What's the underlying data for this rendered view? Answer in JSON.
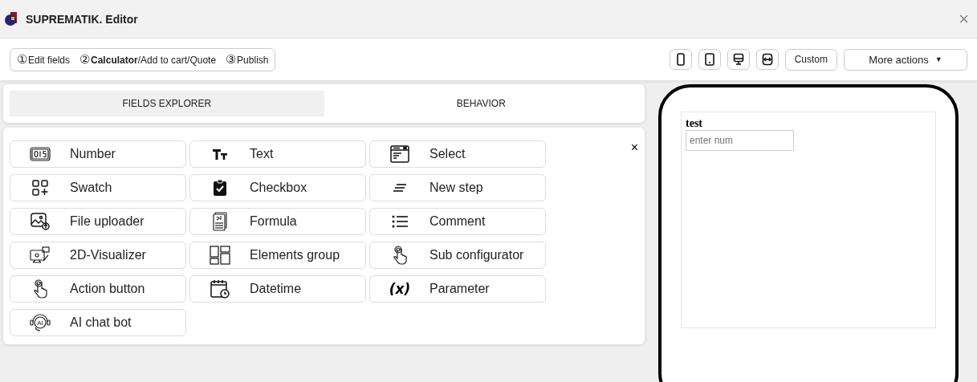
{
  "window": {
    "title": "SUPREMATIK. Editor",
    "close": "×"
  },
  "steps": [
    {
      "number": "①",
      "label": "Edit fields"
    },
    {
      "number": "②",
      "label": "**Calculator**/Add to cart/Quote"
    },
    {
      "number": "③",
      "label": "Publish"
    }
  ],
  "device_buttons": [
    {
      "kind": "phone"
    },
    {
      "kind": "tablet"
    },
    {
      "kind": "desktop"
    },
    {
      "kind": "fit"
    }
  ],
  "custom_button": "Custom",
  "more_actions": {
    "label": "More actions",
    "caret": "▼"
  },
  "tabs": [
    {
      "label": "FIELDS EXPLORER",
      "selected": true
    },
    {
      "label": "BEHAVIOR",
      "selected": false
    }
  ],
  "fields_close": "×",
  "fields": [
    {
      "kind": "number",
      "label": "Number"
    },
    {
      "kind": "text",
      "label": "Text"
    },
    {
      "kind": "select",
      "label": "Select"
    },
    {
      "kind": "swatch",
      "label": "Swatch"
    },
    {
      "kind": "checkbox",
      "label": "Checkbox"
    },
    {
      "kind": "step",
      "label": "New step"
    },
    {
      "kind": "upload",
      "label": "File uploader"
    },
    {
      "kind": "formula",
      "label": "Formula"
    },
    {
      "kind": "comment",
      "label": "Comment"
    },
    {
      "kind": "visualizer",
      "label": "2D-Visualizer"
    },
    {
      "kind": "group",
      "label": "Elements group"
    },
    {
      "kind": "tap",
      "label": "Sub configurator"
    },
    {
      "kind": "tap",
      "label": "Action button"
    },
    {
      "kind": "calendar",
      "label": "Datetime"
    },
    {
      "kind": "parameter",
      "label": "Parameter",
      "glyph": "(x)"
    },
    {
      "kind": "bot",
      "label": "AI chat bot",
      "glyph": "AI"
    }
  ],
  "preview": {
    "field_label": "test",
    "placeholder": "enter num"
  }
}
